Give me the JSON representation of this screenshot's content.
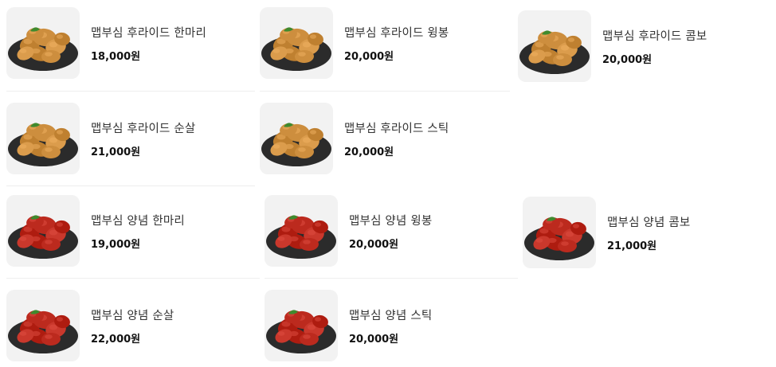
{
  "menu": {
    "items": [
      {
        "name": "맵부심 후라이드 한마리",
        "price": "18,000원",
        "flavor": "fried",
        "icon": "fried-chicken-whole-image"
      },
      {
        "name": "맵부심 후라이드 윙봉",
        "price": "20,000원",
        "flavor": "fried",
        "icon": "fried-chicken-wings-image"
      },
      {
        "name": "맵부심 후라이드 콤보",
        "price": "20,000원",
        "flavor": "fried",
        "icon": "fried-chicken-combo-image"
      },
      {
        "name": "맵부심 후라이드 순살",
        "price": "21,000원",
        "flavor": "fried",
        "icon": "fried-chicken-boneless-image"
      },
      {
        "name": "맵부심 후라이드 스틱",
        "price": "20,000원",
        "flavor": "fried",
        "icon": "fried-chicken-stick-image"
      },
      {
        "name": "맵부심 양념 한마리",
        "price": "19,000원",
        "flavor": "seasoned",
        "icon": "seasoned-chicken-whole-image"
      },
      {
        "name": "맵부심 양념 윙봉",
        "price": "20,000원",
        "flavor": "seasoned",
        "icon": "seasoned-chicken-wings-image"
      },
      {
        "name": "맵부심 양념 콤보",
        "price": "21,000원",
        "flavor": "seasoned",
        "icon": "seasoned-chicken-combo-image"
      },
      {
        "name": "맵부심 양념 순살",
        "price": "22,000원",
        "flavor": "seasoned",
        "icon": "seasoned-chicken-boneless-image"
      },
      {
        "name": "맵부심 양념 스틱",
        "price": "20,000원",
        "flavor": "seasoned",
        "icon": "seasoned-chicken-stick-image"
      }
    ]
  },
  "colors": {
    "fried_chicken": "#c98a3a",
    "seasoned_chicken": "#b8261a",
    "plate": "#2b2b2b",
    "card_bg": "#f2f2f2",
    "divider": "#eeeeee"
  }
}
